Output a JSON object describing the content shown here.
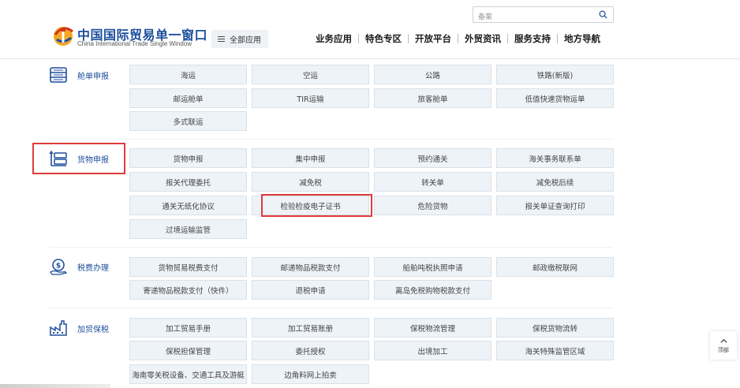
{
  "header": {
    "brand_cn": "中国国际贸易单一窗口",
    "brand_en": "China International Trade Single Window",
    "all_apps_label": "全部应用",
    "search_placeholder": "备案",
    "nav": [
      "业务应用",
      "特色专区",
      "开放平台",
      "外贸资讯",
      "服务支持",
      "地方导航"
    ]
  },
  "sections": [
    {
      "label": "舱单申报",
      "icon": "manifest-icon",
      "items": [
        "海运",
        "空运",
        "公路",
        "铁路(新版)",
        "邮运舱单",
        "TIR运输",
        "旅客舱单",
        "低值快速货物运单",
        "多式联运"
      ]
    },
    {
      "label": "货物申报",
      "icon": "cargo-icon",
      "items": [
        "货物申报",
        "集中申报",
        "预约通关",
        "海关事务联系单",
        "报关代理委托",
        "减免税",
        "转关单",
        "减免税后续",
        "通关无纸化协议",
        "检验检疫电子证书",
        "危险货物",
        "报关单证查询打印",
        "过境运输监管"
      ]
    },
    {
      "label": "税费办理",
      "icon": "tax-icon",
      "items": [
        "货物贸易税费支付",
        "邮递物品税款支付",
        "船舶吨税执照申请",
        "邮政缴税联网",
        "寄递物品税款支付（快件）",
        "退税申请",
        "离岛免税购物税款支付"
      ]
    },
    {
      "label": "加贸保税",
      "icon": "factory-icon",
      "items": [
        "加工贸易手册",
        "加工贸易账册",
        "保税物流管理",
        "保税货物流转",
        "保税担保管理",
        "委托授权",
        "出境加工",
        "海关特殊监管区域",
        "海南零关税设备、交通工具及游艇",
        "边角料网上拍卖"
      ]
    }
  ],
  "back_to_top": "顶部",
  "colors": {
    "brand": "#1e4f9c",
    "tile_bg": "#eef3f8",
    "highlight": "#e03b3b"
  }
}
